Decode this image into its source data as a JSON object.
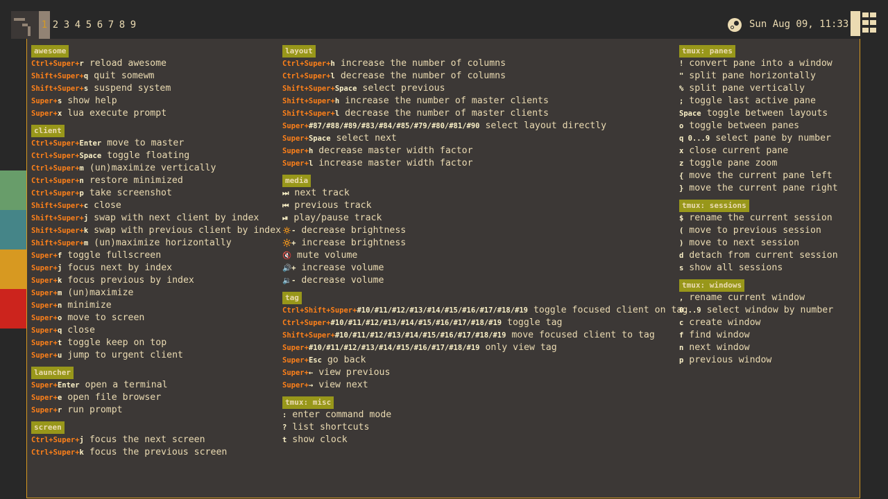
{
  "topbar": {
    "tags": [
      "1",
      "2",
      "3",
      "4",
      "5",
      "6",
      "7",
      "8",
      "9"
    ],
    "active_tag": "1",
    "clock": "Sun Aug 09, 11:33"
  },
  "colors": {
    "background": "#282828",
    "popup": "#3c3836",
    "border": "#d79921",
    "group_title": "#98971a",
    "modifier": "#fe8019",
    "text": "#ebdbb2",
    "strips": [
      "#689d6a",
      "#458588",
      "#d79921",
      "#cc241d"
    ]
  },
  "icons": {
    "launcher": "awesome-launcher-icon",
    "tray": "steam-icon",
    "layout": "tile-layout-icon"
  },
  "columns": [
    [
      {
        "title": "awesome",
        "items": [
          {
            "mod": "Ctrl+Super+",
            "key": "r",
            "desc": "reload awesome"
          },
          {
            "mod": "Shift+Super+",
            "key": "q",
            "desc": "quit somewm"
          },
          {
            "mod": "Shift+Super+",
            "key": "s",
            "desc": "suspend system"
          },
          {
            "mod": "Super+",
            "key": "s",
            "desc": "show help"
          },
          {
            "mod": "Super+",
            "key": "x",
            "desc": "lua execute prompt"
          }
        ]
      },
      {
        "title": "client",
        "items": [
          {
            "mod": "Ctrl+Super+",
            "key": "Enter",
            "desc": "move to master"
          },
          {
            "mod": "Ctrl+Super+",
            "key": "Space",
            "desc": "toggle floating"
          },
          {
            "mod": "Ctrl+Super+",
            "key": "m",
            "desc": "(un)maximize vertically"
          },
          {
            "mod": "Ctrl+Super+",
            "key": "n",
            "desc": "restore minimized"
          },
          {
            "mod": "Ctrl+Super+",
            "key": "p",
            "desc": "take screenshot"
          },
          {
            "mod": "Shift+Super+",
            "key": "c",
            "desc": "close"
          },
          {
            "mod": "Shift+Super+",
            "key": "j",
            "desc": "swap with next client by index"
          },
          {
            "mod": "Shift+Super+",
            "key": "k",
            "desc": "swap with previous client by index"
          },
          {
            "mod": "Shift+Super+",
            "key": "m",
            "desc": "(un)maximize horizontally"
          },
          {
            "mod": "Super+",
            "key": "f",
            "desc": "toggle fullscreen"
          },
          {
            "mod": "Super+",
            "key": "j",
            "desc": "focus next by index"
          },
          {
            "mod": "Super+",
            "key": "k",
            "desc": "focus previous by index"
          },
          {
            "mod": "Super+",
            "key": "m",
            "desc": "(un)maximize"
          },
          {
            "mod": "Super+",
            "key": "n",
            "desc": "minimize"
          },
          {
            "mod": "Super+",
            "key": "o",
            "desc": "move to screen"
          },
          {
            "mod": "Super+",
            "key": "q",
            "desc": "close"
          },
          {
            "mod": "Super+",
            "key": "t",
            "desc": "toggle keep on top"
          },
          {
            "mod": "Super+",
            "key": "u",
            "desc": "jump to urgent client"
          }
        ]
      },
      {
        "title": "launcher",
        "items": [
          {
            "mod": "Super+",
            "key": "Enter",
            "desc": "open a terminal"
          },
          {
            "mod": "Super+",
            "key": "e",
            "desc": "open file browser"
          },
          {
            "mod": "Super+",
            "key": "r",
            "desc": "run prompt"
          }
        ]
      },
      {
        "title": "screen",
        "items": [
          {
            "mod": "Ctrl+Super+",
            "key": "j",
            "desc": "focus the next screen"
          },
          {
            "mod": "Ctrl+Super+",
            "key": "k",
            "desc": "focus the previous screen"
          }
        ]
      }
    ],
    [
      {
        "title": "layout",
        "items": [
          {
            "mod": "Ctrl+Super+",
            "key": "h",
            "desc": "increase the number of columns"
          },
          {
            "mod": "Ctrl+Super+",
            "key": "l",
            "desc": "decrease the number of columns"
          },
          {
            "mod": "Shift+Super+",
            "key": "Space",
            "desc": "select previous"
          },
          {
            "mod": "Shift+Super+",
            "key": "h",
            "desc": "increase the number of master clients"
          },
          {
            "mod": "Shift+Super+",
            "key": "l",
            "desc": "decrease the number of master clients"
          },
          {
            "mod": "Super+",
            "key": "#87/#88/#89/#83/#84/#85/#79/#80/#81/#90",
            "desc": "select layout directly"
          },
          {
            "mod": "Super+",
            "key": "Space",
            "desc": "select next"
          },
          {
            "mod": "Super+",
            "key": "h",
            "desc": "decrease master width factor"
          },
          {
            "mod": "Super+",
            "key": "l",
            "desc": "increase master width factor"
          }
        ]
      },
      {
        "title": "media",
        "items": [
          {
            "mod": "",
            "key": "⏭",
            "desc": "next track"
          },
          {
            "mod": "",
            "key": "⏮",
            "desc": "previous track"
          },
          {
            "mod": "",
            "key": "⏯",
            "desc": "play/pause track"
          },
          {
            "mod": "",
            "key": "🔅-",
            "desc": "decrease brightness"
          },
          {
            "mod": "",
            "key": "🔆+",
            "desc": "increase brightness"
          },
          {
            "mod": "",
            "key": "🔇",
            "desc": "mute volume"
          },
          {
            "mod": "",
            "key": "🔊+",
            "desc": "increase volume"
          },
          {
            "mod": "",
            "key": "🔉-",
            "desc": "decrease volume"
          }
        ]
      },
      {
        "title": "tag",
        "items": [
          {
            "mod": "Ctrl+Shift+Super+",
            "key": "#10/#11/#12/#13/#14/#15/#16/#17/#18/#19",
            "desc": "toggle focused client on tag"
          },
          {
            "mod": "Ctrl+Super+",
            "key": "#10/#11/#12/#13/#14/#15/#16/#17/#18/#19",
            "desc": "toggle tag"
          },
          {
            "mod": "Shift+Super+",
            "key": "#10/#11/#12/#13/#14/#15/#16/#17/#18/#19",
            "desc": "move focused client to tag"
          },
          {
            "mod": "Super+",
            "key": "#10/#11/#12/#13/#14/#15/#16/#17/#18/#19",
            "desc": "only view tag"
          },
          {
            "mod": "Super+",
            "key": "Esc",
            "desc": "go back"
          },
          {
            "mod": "Super+",
            "key": "←",
            "desc": "view previous"
          },
          {
            "mod": "Super+",
            "key": "→",
            "desc": "view next"
          }
        ]
      },
      {
        "title": "tmux: misc",
        "items": [
          {
            "mod": "",
            "key": ":",
            "desc": "enter command mode"
          },
          {
            "mod": "",
            "key": "?",
            "desc": "list shortcuts"
          },
          {
            "mod": "",
            "key": "t",
            "desc": "show clock"
          }
        ]
      }
    ],
    [
      {
        "title": "tmux: panes",
        "items": [
          {
            "mod": "",
            "key": "!",
            "desc": "convert pane into a window"
          },
          {
            "mod": "",
            "key": "\"",
            "desc": "split pane horizontally"
          },
          {
            "mod": "",
            "key": "%",
            "desc": "split pane vertically"
          },
          {
            "mod": "",
            "key": ";",
            "desc": "toggle last active pane"
          },
          {
            "mod": "",
            "key": "Space",
            "desc": "toggle between layouts"
          },
          {
            "mod": "",
            "key": "o",
            "desc": "toggle between panes"
          },
          {
            "mod": "",
            "key": "q 0...9",
            "desc": "select pane by number"
          },
          {
            "mod": "",
            "key": "x",
            "desc": "close current pane"
          },
          {
            "mod": "",
            "key": "z",
            "desc": "toggle pane zoom"
          },
          {
            "mod": "",
            "key": "{",
            "desc": "move the current pane left"
          },
          {
            "mod": "",
            "key": "}",
            "desc": "move the current pane right"
          }
        ]
      },
      {
        "title": "tmux: sessions",
        "items": [
          {
            "mod": "",
            "key": "$",
            "desc": "rename the current session"
          },
          {
            "mod": "",
            "key": "(",
            "desc": "move to previous session"
          },
          {
            "mod": "",
            "key": ")",
            "desc": "move to next session"
          },
          {
            "mod": "",
            "key": "d",
            "desc": "detach from current session"
          },
          {
            "mod": "",
            "key": "s",
            "desc": "show all sessions"
          }
        ]
      },
      {
        "title": "tmux: windows",
        "items": [
          {
            "mod": "",
            "key": ",",
            "desc": "rename current window"
          },
          {
            "mod": "",
            "key": "0...9",
            "desc": "select window by number"
          },
          {
            "mod": "",
            "key": "c",
            "desc": "create window"
          },
          {
            "mod": "",
            "key": "f",
            "desc": "find window"
          },
          {
            "mod": "",
            "key": "n",
            "desc": "next window"
          },
          {
            "mod": "",
            "key": "p",
            "desc": "previous window"
          }
        ]
      }
    ]
  ]
}
